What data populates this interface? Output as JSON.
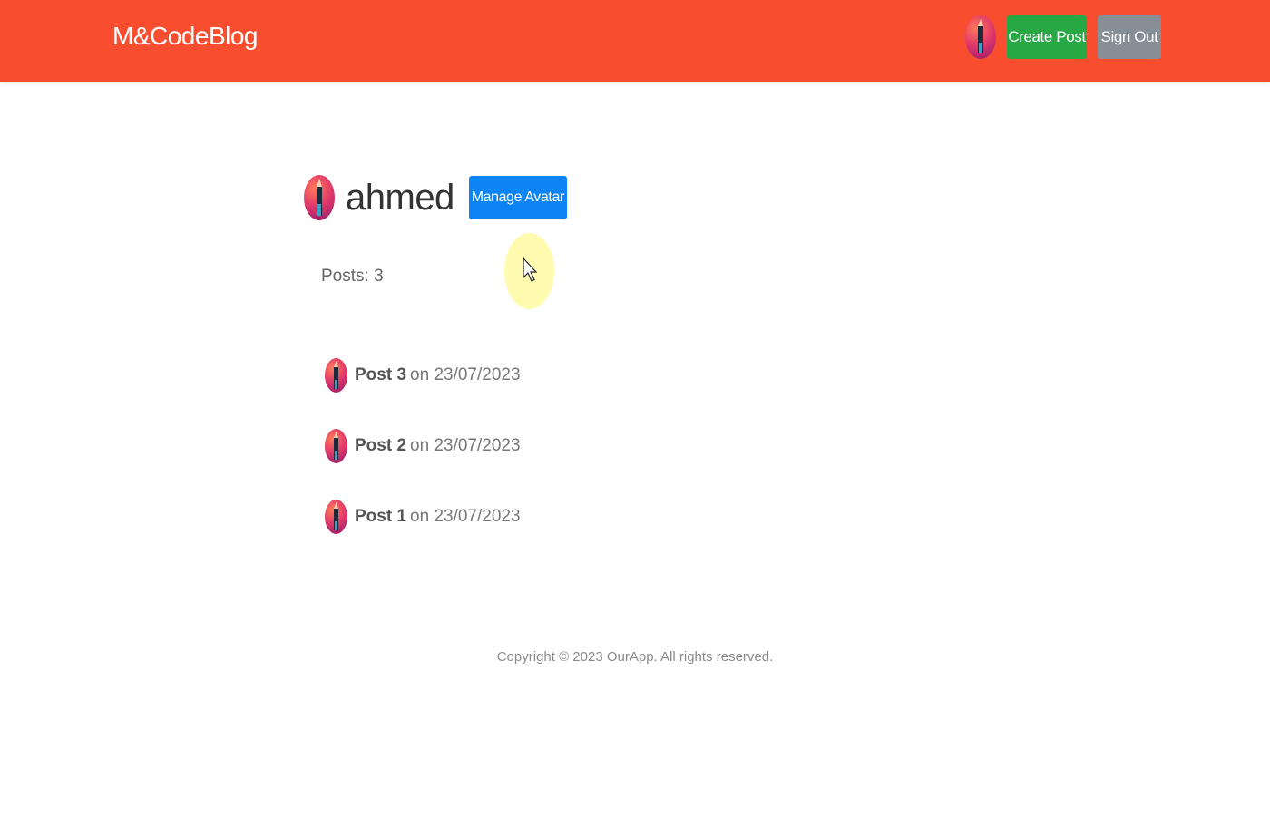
{
  "header": {
    "brand": "M&CodeBlog",
    "create_post_label": "Create Post",
    "sign_out_label": "Sign Out",
    "bg_color": "#f94d2f"
  },
  "profile": {
    "username": "ahmed",
    "manage_avatar_label": "Manage Avatar",
    "posts_count": "Posts: 3"
  },
  "posts": [
    {
      "title": "Post 3",
      "date": "on 23/07/2023"
    },
    {
      "title": "Post 2",
      "date": "on 23/07/2023"
    },
    {
      "title": "Post 1",
      "date": "on 23/07/2023"
    }
  ],
  "footer": {
    "copyright": "Copyright © 2023 OurApp. All rights reserved."
  },
  "icons": [
    "avatar-icon",
    "cursor-icon"
  ],
  "colors": {
    "header": "#f94d2f",
    "create_post": "#28a745",
    "sign_out": "#868e96",
    "manage_avatar": "#0d84f5"
  }
}
